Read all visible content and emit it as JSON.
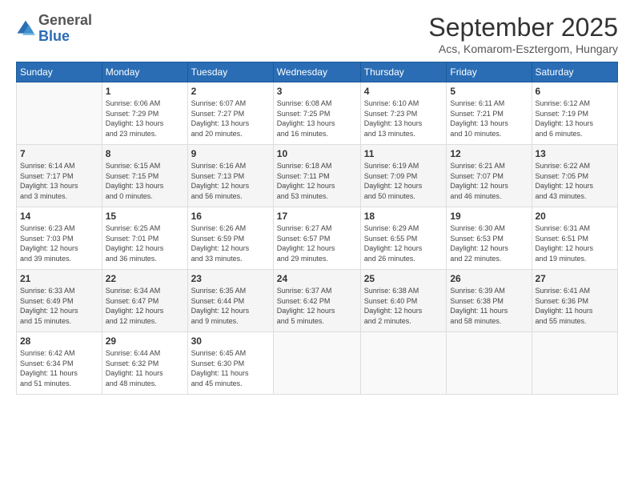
{
  "logo": {
    "general": "General",
    "blue": "Blue"
  },
  "header": {
    "month": "September 2025",
    "location": "Acs, Komarom-Esztergom, Hungary"
  },
  "days_of_week": [
    "Sunday",
    "Monday",
    "Tuesday",
    "Wednesday",
    "Thursday",
    "Friday",
    "Saturday"
  ],
  "weeks": [
    [
      {
        "day": "",
        "info": ""
      },
      {
        "day": "1",
        "info": "Sunrise: 6:06 AM\nSunset: 7:29 PM\nDaylight: 13 hours\nand 23 minutes."
      },
      {
        "day": "2",
        "info": "Sunrise: 6:07 AM\nSunset: 7:27 PM\nDaylight: 13 hours\nand 20 minutes."
      },
      {
        "day": "3",
        "info": "Sunrise: 6:08 AM\nSunset: 7:25 PM\nDaylight: 13 hours\nand 16 minutes."
      },
      {
        "day": "4",
        "info": "Sunrise: 6:10 AM\nSunset: 7:23 PM\nDaylight: 13 hours\nand 13 minutes."
      },
      {
        "day": "5",
        "info": "Sunrise: 6:11 AM\nSunset: 7:21 PM\nDaylight: 13 hours\nand 10 minutes."
      },
      {
        "day": "6",
        "info": "Sunrise: 6:12 AM\nSunset: 7:19 PM\nDaylight: 13 hours\nand 6 minutes."
      }
    ],
    [
      {
        "day": "7",
        "info": "Sunrise: 6:14 AM\nSunset: 7:17 PM\nDaylight: 13 hours\nand 3 minutes."
      },
      {
        "day": "8",
        "info": "Sunrise: 6:15 AM\nSunset: 7:15 PM\nDaylight: 13 hours\nand 0 minutes."
      },
      {
        "day": "9",
        "info": "Sunrise: 6:16 AM\nSunset: 7:13 PM\nDaylight: 12 hours\nand 56 minutes."
      },
      {
        "day": "10",
        "info": "Sunrise: 6:18 AM\nSunset: 7:11 PM\nDaylight: 12 hours\nand 53 minutes."
      },
      {
        "day": "11",
        "info": "Sunrise: 6:19 AM\nSunset: 7:09 PM\nDaylight: 12 hours\nand 50 minutes."
      },
      {
        "day": "12",
        "info": "Sunrise: 6:21 AM\nSunset: 7:07 PM\nDaylight: 12 hours\nand 46 minutes."
      },
      {
        "day": "13",
        "info": "Sunrise: 6:22 AM\nSunset: 7:05 PM\nDaylight: 12 hours\nand 43 minutes."
      }
    ],
    [
      {
        "day": "14",
        "info": "Sunrise: 6:23 AM\nSunset: 7:03 PM\nDaylight: 12 hours\nand 39 minutes."
      },
      {
        "day": "15",
        "info": "Sunrise: 6:25 AM\nSunset: 7:01 PM\nDaylight: 12 hours\nand 36 minutes."
      },
      {
        "day": "16",
        "info": "Sunrise: 6:26 AM\nSunset: 6:59 PM\nDaylight: 12 hours\nand 33 minutes."
      },
      {
        "day": "17",
        "info": "Sunrise: 6:27 AM\nSunset: 6:57 PM\nDaylight: 12 hours\nand 29 minutes."
      },
      {
        "day": "18",
        "info": "Sunrise: 6:29 AM\nSunset: 6:55 PM\nDaylight: 12 hours\nand 26 minutes."
      },
      {
        "day": "19",
        "info": "Sunrise: 6:30 AM\nSunset: 6:53 PM\nDaylight: 12 hours\nand 22 minutes."
      },
      {
        "day": "20",
        "info": "Sunrise: 6:31 AM\nSunset: 6:51 PM\nDaylight: 12 hours\nand 19 minutes."
      }
    ],
    [
      {
        "day": "21",
        "info": "Sunrise: 6:33 AM\nSunset: 6:49 PM\nDaylight: 12 hours\nand 15 minutes."
      },
      {
        "day": "22",
        "info": "Sunrise: 6:34 AM\nSunset: 6:47 PM\nDaylight: 12 hours\nand 12 minutes."
      },
      {
        "day": "23",
        "info": "Sunrise: 6:35 AM\nSunset: 6:44 PM\nDaylight: 12 hours\nand 9 minutes."
      },
      {
        "day": "24",
        "info": "Sunrise: 6:37 AM\nSunset: 6:42 PM\nDaylight: 12 hours\nand 5 minutes."
      },
      {
        "day": "25",
        "info": "Sunrise: 6:38 AM\nSunset: 6:40 PM\nDaylight: 12 hours\nand 2 minutes."
      },
      {
        "day": "26",
        "info": "Sunrise: 6:39 AM\nSunset: 6:38 PM\nDaylight: 11 hours\nand 58 minutes."
      },
      {
        "day": "27",
        "info": "Sunrise: 6:41 AM\nSunset: 6:36 PM\nDaylight: 11 hours\nand 55 minutes."
      }
    ],
    [
      {
        "day": "28",
        "info": "Sunrise: 6:42 AM\nSunset: 6:34 PM\nDaylight: 11 hours\nand 51 minutes."
      },
      {
        "day": "29",
        "info": "Sunrise: 6:44 AM\nSunset: 6:32 PM\nDaylight: 11 hours\nand 48 minutes."
      },
      {
        "day": "30",
        "info": "Sunrise: 6:45 AM\nSunset: 6:30 PM\nDaylight: 11 hours\nand 45 minutes."
      },
      {
        "day": "",
        "info": ""
      },
      {
        "day": "",
        "info": ""
      },
      {
        "day": "",
        "info": ""
      },
      {
        "day": "",
        "info": ""
      }
    ]
  ]
}
